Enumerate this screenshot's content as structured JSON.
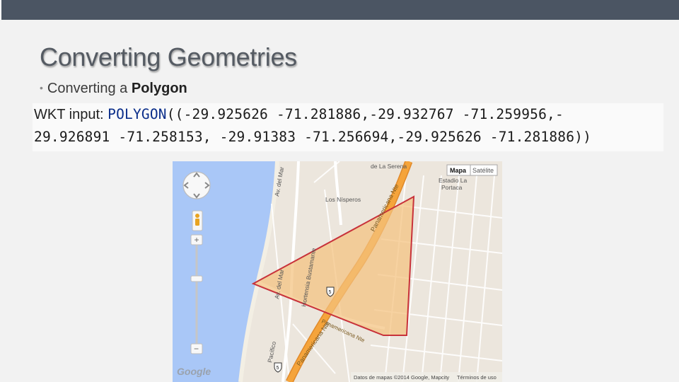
{
  "slide": {
    "title": "Converting Geometries",
    "bullet_prefix": "Converting a",
    "bullet_emphasis": "Polygon"
  },
  "code": {
    "label": "WKT input: ",
    "keyword": "POLYGON",
    "line1_rest": "((-29.925626 -71.281886,-29.932767 -71.259956,-",
    "line2": "29.926891  -71.258153, -29.91383 -71.256694,-29.925626 -71.281886))"
  },
  "map": {
    "controls": {
      "map_button": "Mapa",
      "satellite_button": "Satélite",
      "zoom_in": "+",
      "zoom_out": "−"
    },
    "labels": {
      "road_main": "Panamericana Nte",
      "road_main_2": "Panamericana Nte",
      "road_main_3": "Panamericana Nte",
      "north_label": "de La Serena",
      "stadium_1": "Estadio La",
      "stadium_2": "Portaca",
      "los_nisperos": "Los Nísperos",
      "hortensia": "Hortensia Bustamante",
      "av_del_mar": "Av. del Mar",
      "av_del_mar_2": "Av. del Mar",
      "pacifico": "Pacífico",
      "route_shield_1": "5",
      "route_shield_2": "5",
      "google": "Google",
      "attribution": "Datos de mapas ©2014 Google, Mapcity",
      "terms": "Términos de uso"
    },
    "colors": {
      "water": "#a9c7f7",
      "land": "#ece6dd",
      "highway": "#f5a43b",
      "polygon_fill": "#f4c27e",
      "polygon_stroke": "#c8323a"
    }
  }
}
